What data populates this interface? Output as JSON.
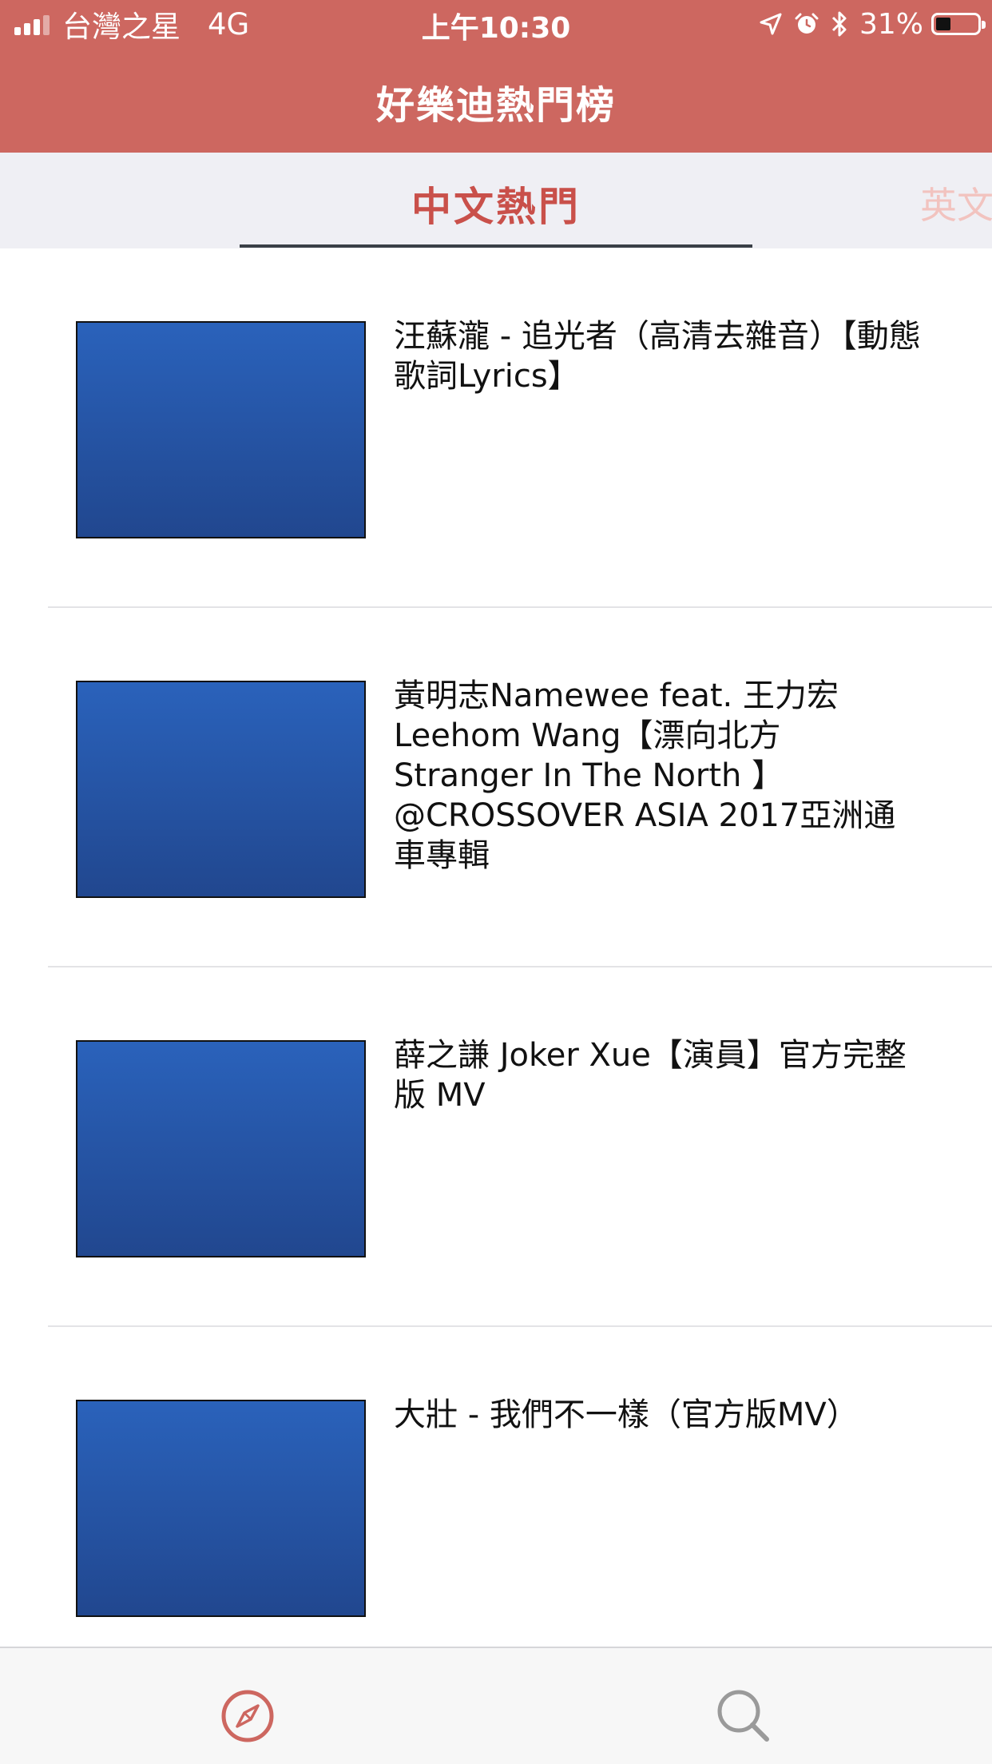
{
  "status_bar": {
    "carrier": "台灣之星",
    "network": "4G",
    "time": "上午10:30",
    "battery": "31%",
    "battery_level": 0.31
  },
  "nav": {
    "title": "好樂迪熱門榜"
  },
  "tabs": {
    "active_label": "中文熱門",
    "next_label": "英文"
  },
  "videos": [
    {
      "title": "汪蘇瀧 - 追光者（高清去雜音）【動態歌詞Lyrics】"
    },
    {
      "title": "黃明志Namewee feat. 王力宏 Leehom Wang【漂向北方 Stranger In The North 】@CROSSOVER ASIA 2017亞洲通車專輯"
    },
    {
      "title": "薛之謙 Joker Xue【演員】官方完整版 MV"
    },
    {
      "title": "大壯 - 我們不一樣（官方版MV）"
    }
  ],
  "tab_bar": {
    "items": [
      {
        "icon": "compass-icon",
        "active": true
      },
      {
        "icon": "search-icon",
        "active": false
      }
    ]
  },
  "colors": {
    "header_bg": "#cd6760",
    "accent": "#c9504a",
    "tab_strip_bg": "#efeff4",
    "thumb_top": "#2a62bb",
    "thumb_bottom": "#21478f",
    "inactive_icon": "#9a9a9a"
  }
}
